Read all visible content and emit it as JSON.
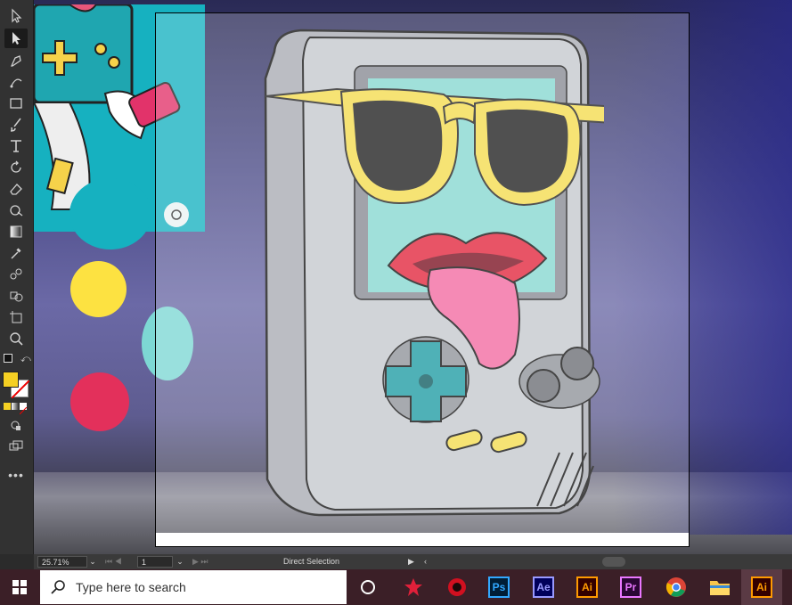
{
  "toolbar": {
    "tools": [
      "selection-tool",
      "direct-selection-tool",
      "pen-tool",
      "curvature-tool",
      "rectangle-tool",
      "paintbrush-tool",
      "type-tool",
      "rotate-tool",
      "eraser-tool",
      "warp-tool",
      "gradient-tool",
      "eyedropper-tool",
      "blend-tool",
      "shape-builder-tool",
      "artboard-tool",
      "zoom-tool"
    ],
    "fill_color": "#f5d023",
    "stroke_color": "none"
  },
  "colors": {
    "circle_teal": "#16b1c0",
    "circle_yellow": "#fde241",
    "circle_mint": "#7dd8d4",
    "circle_pink": "#e3305b",
    "artboard_border": "#000000"
  },
  "status": {
    "zoom": "25.71%",
    "artboard_number": "1",
    "current_tool": "Direct Selection"
  },
  "taskbar": {
    "search_placeholder": "Type here to search",
    "apps": [
      {
        "name": "task-view",
        "label": ""
      },
      {
        "name": "app-red-star",
        "label": ""
      },
      {
        "name": "app-red-circle",
        "label": ""
      },
      {
        "name": "photoshop",
        "label": "Ps"
      },
      {
        "name": "after-effects",
        "label": "Ae"
      },
      {
        "name": "illustrator",
        "label": "Ai"
      },
      {
        "name": "premiere",
        "label": "Pr"
      },
      {
        "name": "chrome",
        "label": ""
      },
      {
        "name": "file-explorer",
        "label": ""
      },
      {
        "name": "illustrator-active",
        "label": "Ai"
      }
    ]
  }
}
